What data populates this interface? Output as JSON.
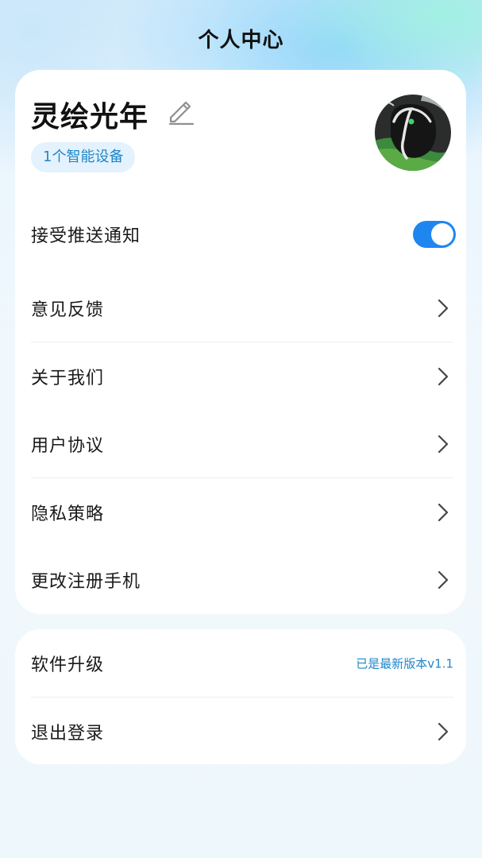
{
  "header": {
    "title": "个人中心"
  },
  "profile": {
    "name": "灵绘光年",
    "device_badge": "1个智能设备"
  },
  "settings": {
    "push_notifications": {
      "label": "接受推送通知",
      "enabled": true
    },
    "items": [
      {
        "label": "意见反馈"
      },
      {
        "label": "关于我们"
      },
      {
        "label": "用户协议"
      },
      {
        "label": "隐私策略"
      },
      {
        "label": "更改注册手机"
      }
    ]
  },
  "system": {
    "upgrade": {
      "label": "软件升级",
      "status": "已是最新版本v1.1"
    },
    "logout": {
      "label": "退出登录"
    }
  },
  "colors": {
    "accent": "#1f86ef",
    "badge_text": "#1f86c9",
    "badge_bg": "#e3f2fc"
  },
  "icons": {
    "edit": "pencil-edit-icon",
    "chevron": "chevron-right-icon"
  }
}
